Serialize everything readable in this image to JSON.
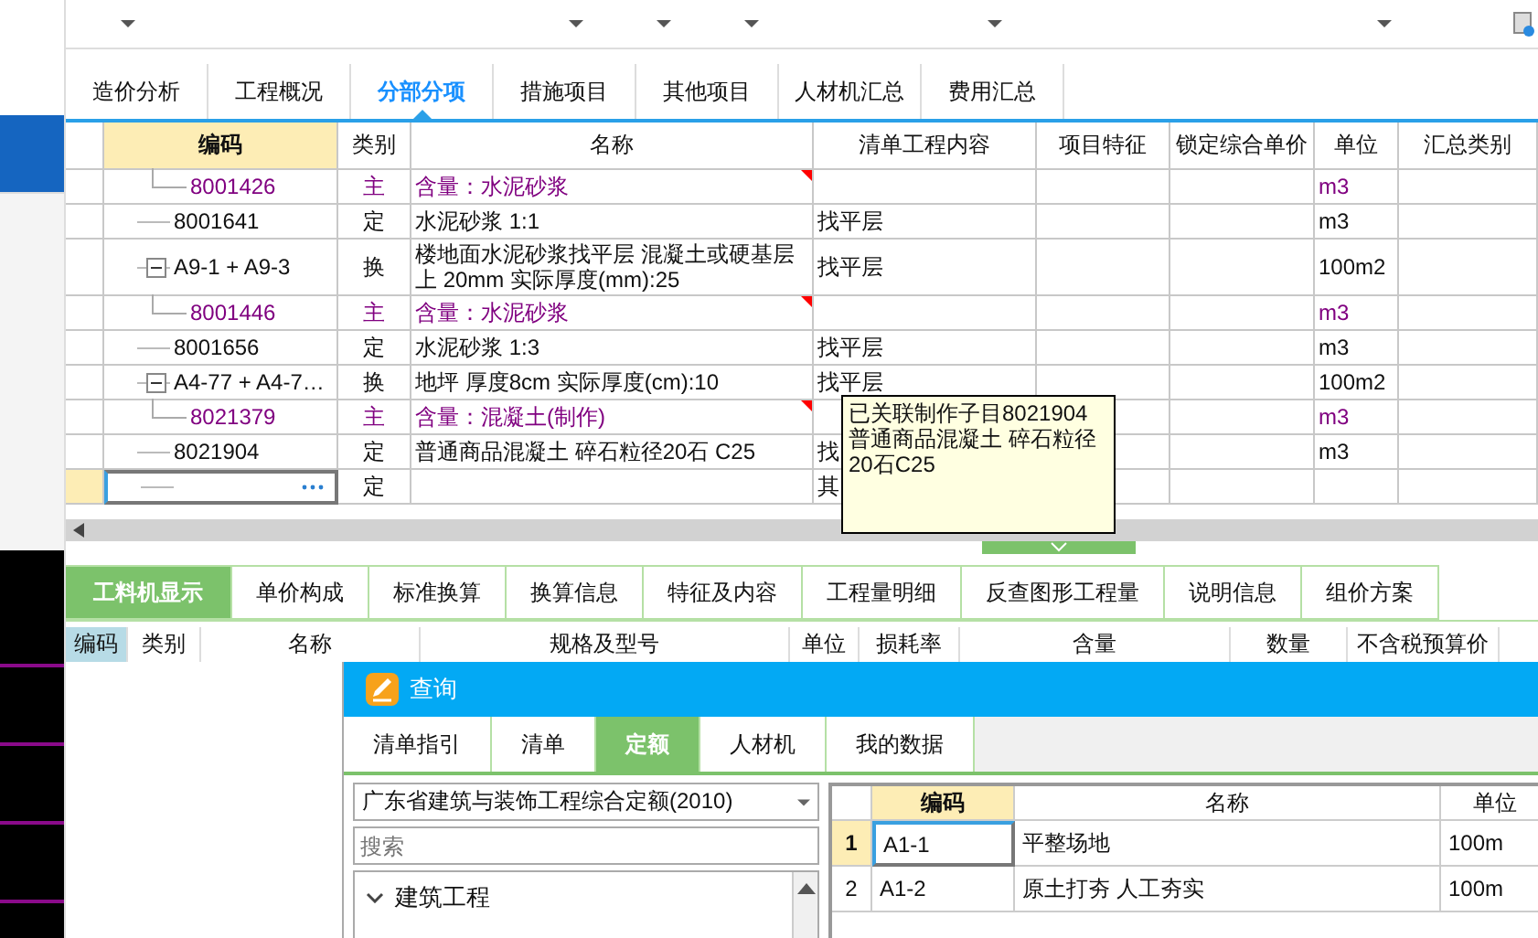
{
  "main_tabs": [
    {
      "label": "造价分析",
      "selected": false
    },
    {
      "label": "工程概况",
      "selected": false
    },
    {
      "label": "分部分项",
      "selected": true
    },
    {
      "label": "措施项目",
      "selected": false
    },
    {
      "label": "其他项目",
      "selected": false
    },
    {
      "label": "人材机汇总",
      "selected": false
    },
    {
      "label": "费用汇总",
      "selected": false
    }
  ],
  "grid": {
    "columns": [
      "编码",
      "类别",
      "名称",
      "清单工程内容",
      "项目特征",
      "锁定综合单价",
      "单位",
      "汇总类别"
    ],
    "rows": [
      {
        "kind": "material",
        "code": "8001426",
        "type": "主",
        "name": "含量：水泥砂浆",
        "unit": "m3",
        "flagged": true,
        "selected": false
      },
      {
        "kind": "quota",
        "code": "8001641",
        "type": "定",
        "name": "水泥砂浆 1:1",
        "content": "找平层",
        "unit": "m3",
        "flagged": false,
        "selected": false
      },
      {
        "kind": "quota",
        "code": "A9-1 + A9-3",
        "type": "换",
        "name": "楼地面水泥砂浆找平层 混凝土或硬基层上 20mm  实际厚度(mm):25",
        "content": "找平层",
        "unit": "100m2",
        "flagged": false,
        "selected": false,
        "expanded": true,
        "children": [
          {
            "kind": "material",
            "code": "8001446",
            "type": "主",
            "name": "含量：水泥砂浆",
            "unit": "m3",
            "flagged": true,
            "selected": false
          }
        ]
      },
      {
        "kind": "quota",
        "code": "8001656",
        "type": "定",
        "name": "水泥砂浆 1:3",
        "content": "找平层",
        "unit": "m3",
        "flagged": false,
        "selected": false
      },
      {
        "kind": "quota",
        "code": "A4-77 + A4-7…",
        "type": "换",
        "name": "地坪 厚度8cm  实际厚度(cm):10",
        "content": "找平层",
        "unit": "100m2",
        "flagged": false,
        "selected": false,
        "expanded": true,
        "children": [
          {
            "kind": "material",
            "code": "8021379",
            "type": "主",
            "name": "含量：混凝土(制作)",
            "unit": "m3",
            "flagged": true,
            "selected": false
          }
        ]
      },
      {
        "kind": "quota",
        "code": "8021904",
        "type": "定",
        "name": "普通商品混凝土 碎石粒径20石 C25",
        "content": "找",
        "unit": "m3",
        "flagged": false,
        "selected": false
      },
      {
        "kind": "new",
        "type": "定",
        "content": "其",
        "flagged": false,
        "selected": true
      }
    ]
  },
  "tooltip": {
    "text": "已关联制作子目8021904 普通商品混凝土 碎石粒径20石C25"
  },
  "detail_tabs": [
    {
      "label": "工料机显示",
      "selected": true
    },
    {
      "label": "单价构成",
      "selected": false
    },
    {
      "label": "标准换算",
      "selected": false
    },
    {
      "label": "换算信息",
      "selected": false
    },
    {
      "label": "特征及内容",
      "selected": false
    },
    {
      "label": "工程量明细",
      "selected": false
    },
    {
      "label": "反查图形工程量",
      "selected": false
    },
    {
      "label": "说明信息",
      "selected": false
    },
    {
      "label": "组价方案",
      "selected": false
    }
  ],
  "detail_columns": [
    "编码",
    "类别",
    "名称",
    "规格及型号",
    "单位",
    "损耗率",
    "含量",
    "数量",
    "不含税预算价"
  ],
  "query_dialog": {
    "title": "查询",
    "tabs": [
      {
        "label": "清单指引",
        "selected": false
      },
      {
        "label": "清单",
        "selected": false
      },
      {
        "label": "定额",
        "selected": true
      },
      {
        "label": "人材机",
        "selected": false
      },
      {
        "label": "我的数据",
        "selected": false
      }
    ],
    "library": "广东省建筑与装饰工程综合定额(2010)",
    "search": {
      "placeholder": "搜索"
    },
    "tree": [
      {
        "label": "建筑工程",
        "expanded": true
      }
    ],
    "columns": [
      "编码",
      "名称",
      "单位"
    ],
    "rows": [
      {
        "index": "1",
        "code": "A1-1",
        "name": "平整场地",
        "unit": "100m",
        "selected": true
      },
      {
        "index": "2",
        "code": "A1-2",
        "name": "原土打夯 人工夯实",
        "unit": "100m",
        "selected": false
      }
    ]
  }
}
